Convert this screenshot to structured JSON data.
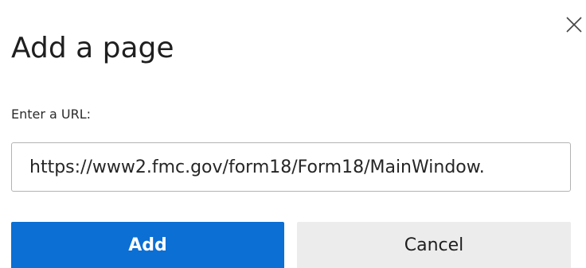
{
  "dialog": {
    "title": "Add a page",
    "close_icon": "close-icon",
    "url_label": "Enter a URL:",
    "url_value": "https://www2.fmc.gov/form18/Form18/MainWindow.",
    "add_label": "Add",
    "cancel_label": "Cancel"
  },
  "colors": {
    "primary_button": "#0b6fd4",
    "secondary_button": "#ececec",
    "input_border": "#b3b3b3"
  }
}
